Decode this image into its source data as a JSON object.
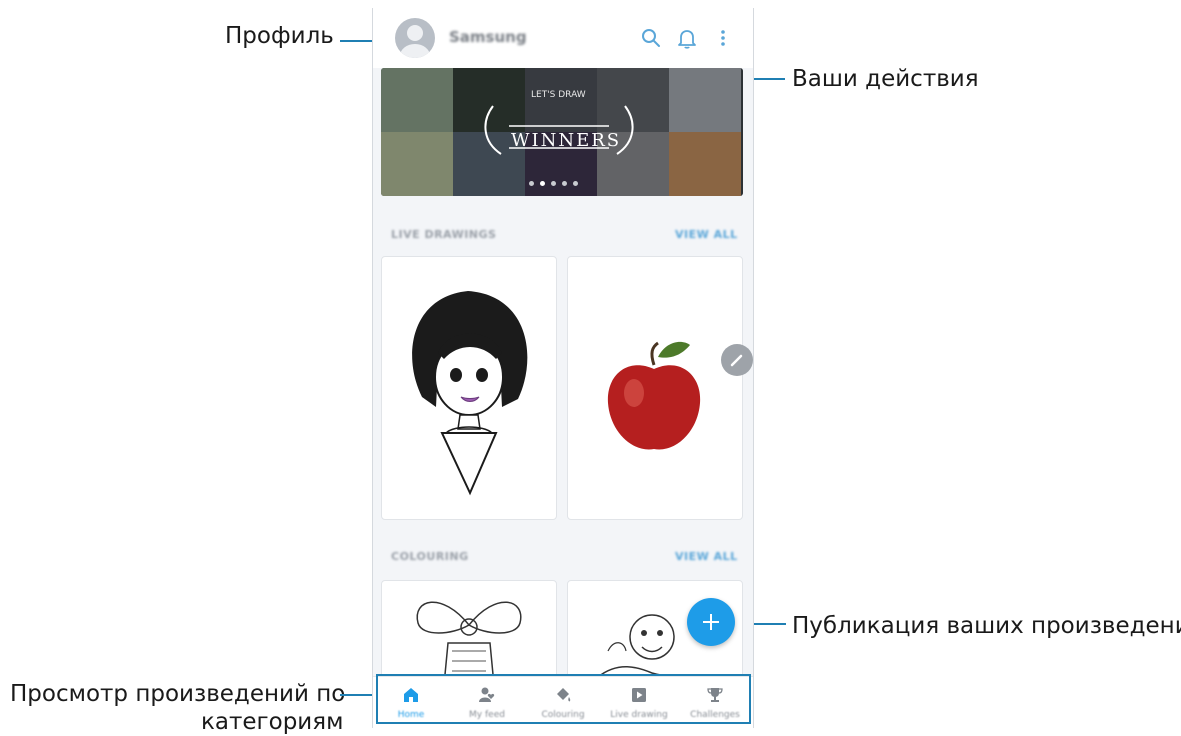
{
  "callouts": {
    "profile": "Профиль",
    "activity": "Ваши действия",
    "publish": "Публикация ваших произведений",
    "browse_line1": "Просмотр произведений по",
    "browse_line2": "категориям"
  },
  "app": {
    "account_name": "Samsung",
    "icons": [
      "search-icon",
      "bell-icon",
      "more-vertical-icon"
    ]
  },
  "banner": {
    "text_line1": "LET'S DRAW",
    "text_line2": "WINNERS",
    "pages": 5,
    "active_page": 2
  },
  "sections": [
    {
      "title": "LIVE DRAWINGS",
      "action": "VIEW ALL"
    },
    {
      "title": "COLOURING",
      "action": "VIEW ALL"
    }
  ],
  "bottom_nav": [
    {
      "label": "Home",
      "icon": "home-icon",
      "active": true
    },
    {
      "label": "My feed",
      "icon": "feed-icon",
      "active": false
    },
    {
      "label": "Colouring",
      "icon": "colouring-icon",
      "active": false
    },
    {
      "label": "Live drawing",
      "icon": "play-icon",
      "active": false
    },
    {
      "label": "Challenges",
      "icon": "trophy-icon",
      "active": false
    }
  ],
  "colors": {
    "accent": "#1e9ce8",
    "callout_line": "#1f7fb3",
    "background": "#f3f5f8"
  }
}
